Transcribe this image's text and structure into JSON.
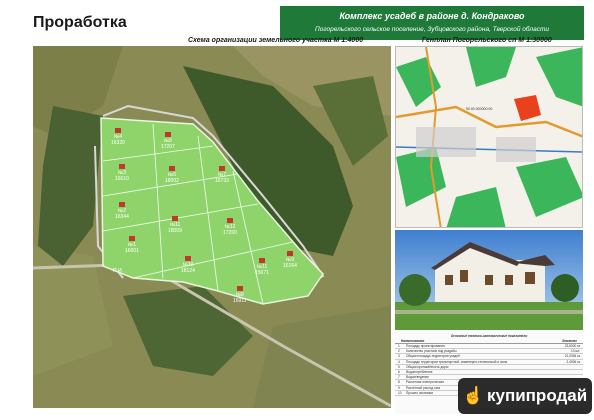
{
  "header": {
    "title": "Проработка",
    "banner_line1": "Комплекс усадеб в районе д. Кондраково",
    "banner_line2": "Погорельского сельское поселение, Зубцовского района, Тверской области"
  },
  "scheme": {
    "caption": "Схема организации земельного участка М 1:4000",
    "plots": [
      {
        "num": "№4",
        "area": "16320"
      },
      {
        "num": "№5",
        "area": "17207"
      },
      {
        "num": "№3",
        "area": "16610"
      },
      {
        "num": "№6",
        "area": "18002"
      },
      {
        "num": "№7",
        "area": "16733"
      },
      {
        "num": "№2",
        "area": "16344"
      },
      {
        "num": "№11",
        "area": "18009"
      },
      {
        "num": "№12",
        "area": "17260"
      },
      {
        "num": "№1",
        "area": "16001"
      },
      {
        "num": "№10",
        "area": "18124"
      },
      {
        "num": "№9",
        "area": "16164"
      },
      {
        "num": "№8",
        "area": "16911"
      },
      {
        "num": "№11",
        "area": "15671"
      }
    ],
    "road_label": "П.И."
  },
  "genplan": {
    "caption": "Генплан Погорельского сп М 1:30000",
    "site_label": "50.00.000000.00"
  },
  "table": {
    "title": "Основные технико-экономические показатели",
    "col_name": "Наименование",
    "col_value": "Значение",
    "rows": [
      {
        "n": "1",
        "t": "Площадь проектирования",
        "v": "23,6000 га"
      },
      {
        "n": "2",
        "t": "Количество участков под усадьбы",
        "v": "13 шт."
      },
      {
        "n": "3",
        "t": "Общая площадь территории усадеб",
        "v": "21,0394 га"
      },
      {
        "n": "4",
        "t": "Площадь территории транспортной, инженерно-технической и зоны",
        "v": "2,4906 га"
      },
      {
        "n": "5",
        "t": "Общая протяжённость дорог",
        "v": ""
      },
      {
        "n": "6",
        "t": "Водопотребление",
        "v": ""
      },
      {
        "n": "7",
        "t": "Водоотведение",
        "v": ""
      },
      {
        "n": "8",
        "t": "Расчетная электрическая",
        "v": ""
      },
      {
        "n": "9",
        "t": "Расчётный расход газа",
        "v": ""
      },
      {
        "n": "10",
        "t": "Прошло экономии",
        "v": ""
      }
    ]
  },
  "watermark": {
    "icon": "hand-icon",
    "text": "купипродай"
  },
  "colors": {
    "banner": "#1f7a3a",
    "plot_fill": "#8fd46b",
    "house_roof": "#c0392b",
    "site_highlight": "#e8411c"
  }
}
